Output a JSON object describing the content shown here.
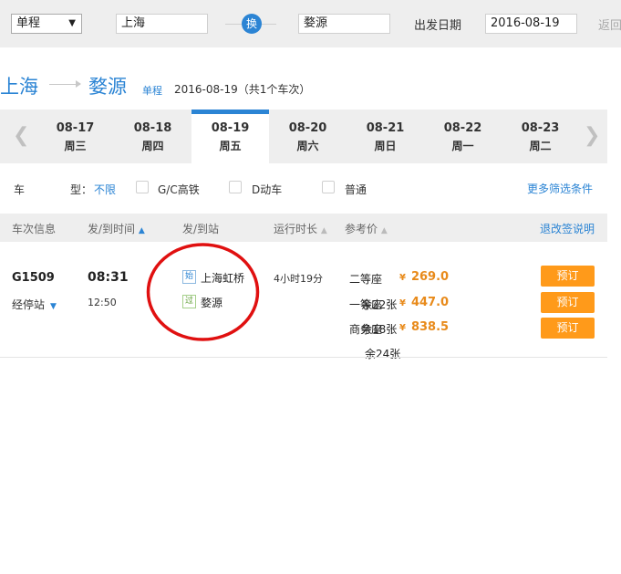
{
  "search": {
    "trip_type": "单程",
    "from": "上海",
    "swap_label": "换",
    "to": "婺源",
    "date_label": "出发日期",
    "date": "2016-08-19",
    "return_label": "返回"
  },
  "route": {
    "from": "上海",
    "to": "婺源",
    "trip_type": "单程",
    "summary": "2016-08-19（共1个车次）"
  },
  "dates": [
    {
      "date": "08-17",
      "weekday": "周三"
    },
    {
      "date": "08-18",
      "weekday": "周四"
    },
    {
      "date": "08-19",
      "weekday": "周五"
    },
    {
      "date": "08-20",
      "weekday": "周六"
    },
    {
      "date": "08-21",
      "weekday": "周日"
    },
    {
      "date": "08-22",
      "weekday": "周一"
    },
    {
      "date": "08-23",
      "weekday": "周二"
    }
  ],
  "filters": {
    "car_label_1": "车",
    "car_label_2": "型：",
    "all": "不限",
    "gc": "G/C高铁",
    "d": "D动车",
    "normal": "普通",
    "more": "更多筛选条件"
  },
  "table_header": {
    "train_info": "车次信息",
    "dep_arr_time": "发/到时间",
    "dep_arr_station": "发/到站",
    "duration": "运行时长",
    "price": "参考价",
    "refund_link": "退改签说明"
  },
  "train": {
    "number": "G1509",
    "stops_label": "经停站",
    "dep_time": "08:31",
    "arr_time": "12:50",
    "start_badge": "始",
    "pass_badge": "过",
    "from_station": "上海虹桥",
    "to_station": "婺源",
    "duration": "4小时19分",
    "seats": [
      {
        "name": "二等座",
        "remain": "",
        "price": "269.0"
      },
      {
        "name": "一等座",
        "remain": "余22张",
        "price": "447.0"
      },
      {
        "name": "商务座",
        "remain": "余18张",
        "price": "838.5"
      }
    ],
    "extra_remain": "余24张",
    "currency": "¥",
    "book_label": "预订"
  },
  "colors": {
    "accent": "#2b84d4",
    "price": "#e88a1a",
    "button": "#ff9a1a",
    "annotation": "#e01010"
  }
}
